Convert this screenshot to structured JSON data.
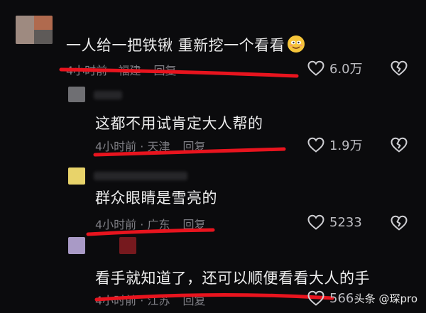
{
  "comments": [
    {
      "text": "一人给一把铁锹  重新挖一个看看",
      "time": "4小时前",
      "location": "福建",
      "reply": "回复",
      "likes": "6.0万"
    },
    {
      "text": "这都不用试肯定大人帮的",
      "time": "4小时前",
      "location": "天津",
      "reply": "回复",
      "likes": "1.9万"
    },
    {
      "text": "群众眼睛是雪亮的",
      "time": "4小时前",
      "location": "广东",
      "reply": "回复",
      "likes": "5233"
    },
    {
      "text": "看手就知道了，还可以顺便看看大人的手",
      "time": "4小时前",
      "location": "江苏",
      "reply": "回复",
      "likes": "566"
    }
  ],
  "meta_separator": " · ",
  "watermark": {
    "text": "头条 @琛pro"
  },
  "colors": {
    "background": "#0b0b0d",
    "underline": "#e8141e",
    "muted": "#7e7e84"
  },
  "icons": [
    "smile-emoji-icon",
    "heart-icon",
    "broken-heart-icon"
  ]
}
